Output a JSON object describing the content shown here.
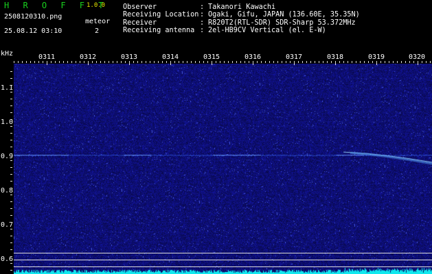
{
  "header": {
    "app_name": "H R O F F T",
    "version": "1.0.0",
    "filename": "2508120310.png",
    "meteor_label": "meteor",
    "meteor_count": "2",
    "datetime": "25.08.12 03:10"
  },
  "info": [
    {
      "label": "Observer",
      "value": "Takanori Kawachi"
    },
    {
      "label": "Receiving Location",
      "value": "Ogaki, Gifu, JAPAN (136.60E, 35.35N)"
    },
    {
      "label": "Receiver",
      "value": "R820T2(RTL-SDR) SDR-Sharp 53.372MHz"
    },
    {
      "label": "Receiving antenna",
      "value": "2el-HB9CV Vertical (el. E-W)"
    }
  ],
  "axes": {
    "unit_label": "kHz",
    "time_labels": [
      "0311",
      "0312",
      "0313",
      "0314",
      "0315",
      "0316",
      "0317",
      "0318",
      "0319",
      "0320"
    ],
    "freq_labels": [
      "1.1",
      "1.0",
      "0.9",
      "0.8",
      "0.7",
      "0.6"
    ]
  },
  "colors": {
    "brand": "#19d11e",
    "version": "#e6e600",
    "background": "#000000",
    "noise_floor": "#10106a",
    "carrier": "#3a6fff",
    "meteor": "#9fe0ff",
    "power_trace": "#10e8ee"
  }
}
